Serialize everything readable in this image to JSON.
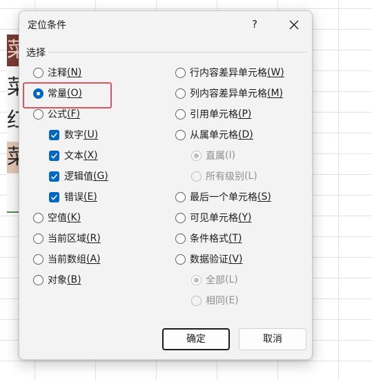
{
  "dialog": {
    "title": "定位条件",
    "help_label": "?",
    "group_label": "选择"
  },
  "sheet": {
    "glyphs": [
      "菜",
      "菜",
      "红",
      "菜"
    ]
  },
  "options_left": [
    {
      "text": "注释",
      "key": "(N)",
      "checked": false
    },
    {
      "text": "常量",
      "key": "(O)",
      "checked": true
    },
    {
      "text": "公式",
      "key": "(F)",
      "checked": false
    }
  ],
  "formula_subs": [
    {
      "text": "数字",
      "key": "(U)",
      "checked": true
    },
    {
      "text": "文本",
      "key": "(X)",
      "checked": true
    },
    {
      "text": "逻辑值",
      "key": "(G)",
      "checked": true
    },
    {
      "text": "错误",
      "key": "(E)",
      "checked": true
    }
  ],
  "options_left_lower": [
    {
      "text": "空值",
      "key": "(K)",
      "checked": false
    },
    {
      "text": "当前区域",
      "key": "(R)",
      "checked": false
    },
    {
      "text": "当前数组",
      "key": "(A)",
      "checked": false
    },
    {
      "text": "对象",
      "key": "(B)",
      "checked": false
    }
  ],
  "options_right": [
    {
      "text": "行内容差异单元格",
      "key": "(W)",
      "checked": false
    },
    {
      "text": "列内容差异单元格",
      "key": "(M)",
      "checked": false
    },
    {
      "text": "引用单元格",
      "key": "(P)",
      "checked": false
    },
    {
      "text": "从属单元格",
      "key": "(D)",
      "checked": false
    }
  ],
  "dependents_subs": [
    {
      "text": "直属",
      "key": "(I)",
      "checked": true
    },
    {
      "text": "所有级别",
      "key": "(L)",
      "checked": false
    }
  ],
  "options_right_lower": [
    {
      "text": "最后一个单元格",
      "key": "(S)",
      "checked": false
    },
    {
      "text": "可见单元格",
      "key": "(Y)",
      "checked": false
    },
    {
      "text": "条件格式",
      "key": "(T)",
      "checked": false
    },
    {
      "text": "数据验证",
      "key": "(V)",
      "checked": false
    }
  ],
  "validation_subs": [
    {
      "text": "全部",
      "key": "(L)",
      "checked": true
    },
    {
      "text": "相同",
      "key": "(E)",
      "checked": false
    }
  ],
  "buttons": {
    "ok": "确定",
    "cancel": "取消"
  },
  "colors": {
    "accent": "#0067c0",
    "highlight": "#e0515f"
  }
}
